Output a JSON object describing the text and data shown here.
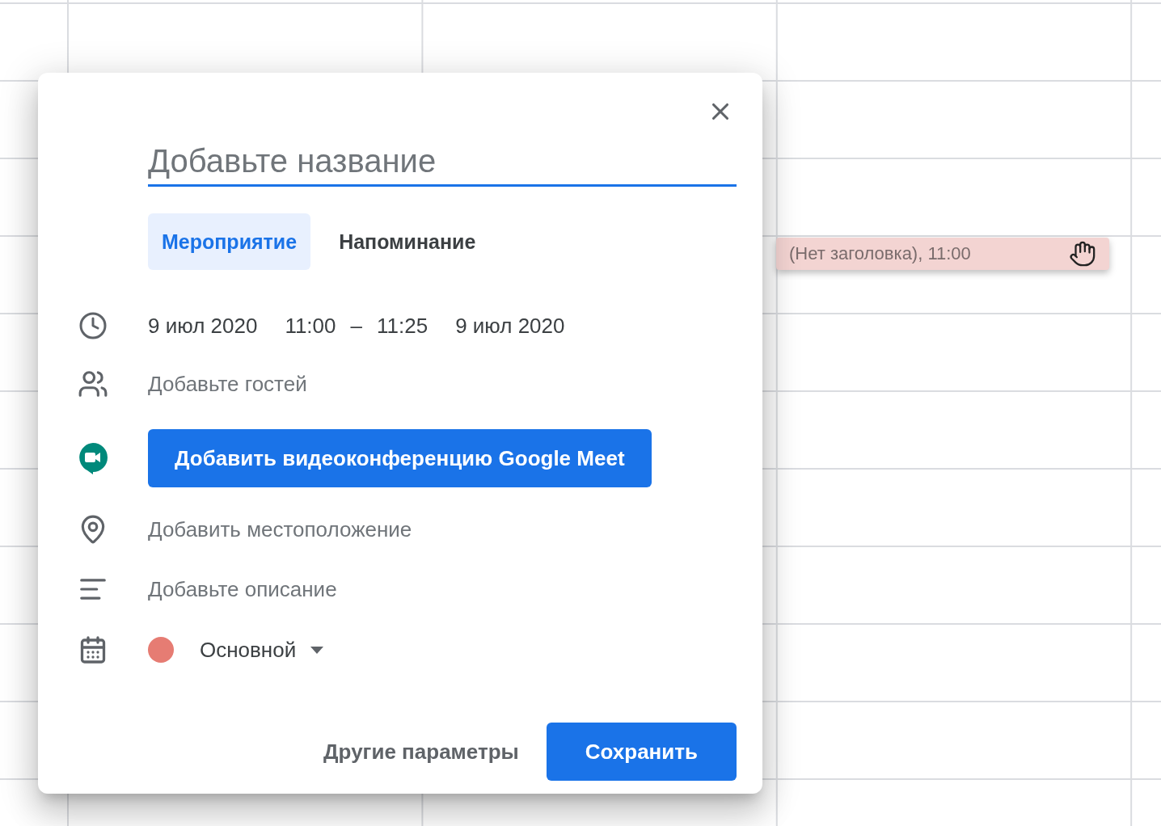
{
  "event_chip": {
    "label": "(Нет заголовка), 11:00"
  },
  "dialog": {
    "title_field": {
      "placeholder": "Добавьте название"
    },
    "tabs": [
      {
        "label": "Мероприятие",
        "selected": true
      },
      {
        "label": "Напоминание",
        "selected": false
      }
    ],
    "date_time": {
      "start_date": "9 июл 2020",
      "start_time": "11:00",
      "separator": "–",
      "end_time": "11:25",
      "end_date": "9 июл 2020"
    },
    "guests": {
      "placeholder": "Добавьте гостей"
    },
    "meet_button": {
      "label": "Добавить видеоконференцию Google Meet"
    },
    "location": {
      "placeholder": "Добавить местоположение"
    },
    "description": {
      "placeholder": "Добавьте описание"
    },
    "calendar": {
      "name": "Основной",
      "color": "#e67c73"
    },
    "footer_buttons": [
      {
        "label": "Другие параметры",
        "kind": "text"
      },
      {
        "label": "Сохранить",
        "kind": "primary"
      }
    ]
  }
}
